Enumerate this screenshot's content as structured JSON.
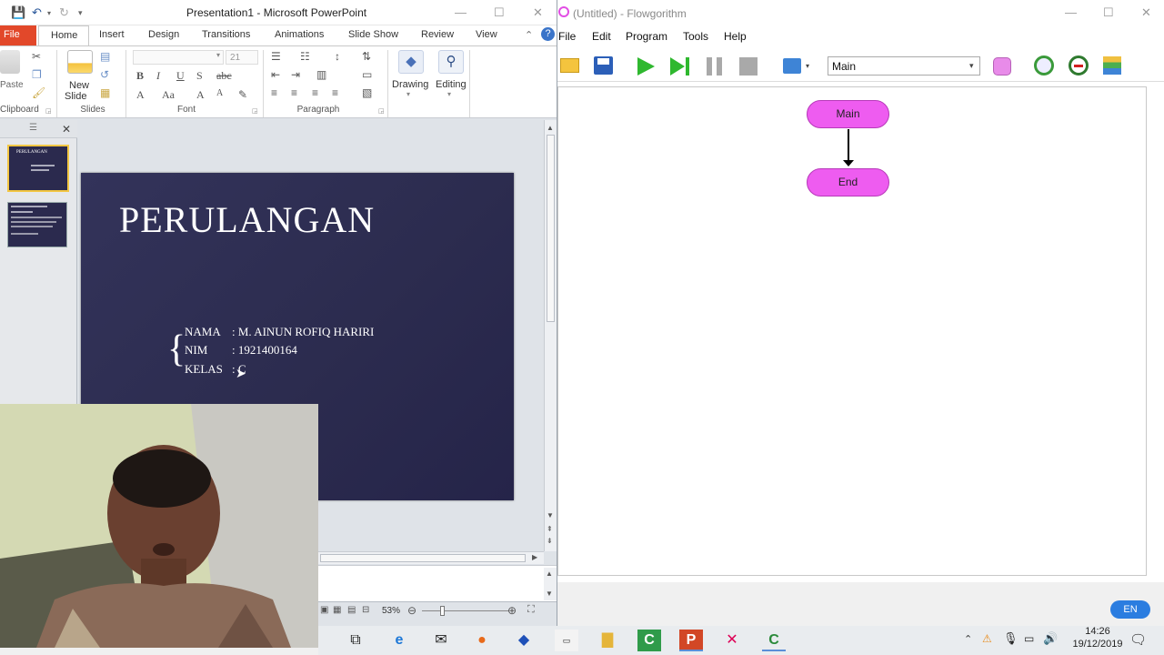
{
  "ppt": {
    "window_title": "Presentation1 - Microsoft PowerPoint",
    "tabs": [
      "File",
      "Home",
      "Insert",
      "Design",
      "Transitions",
      "Animations",
      "Slide Show",
      "Review",
      "View"
    ],
    "ribbon": {
      "paste": "Paste",
      "new_slide_line1": "New",
      "new_slide_line2": "Slide",
      "font_size": "21",
      "drawing": "Drawing",
      "editing": "Editing",
      "groups": {
        "clipboard": "Clipboard",
        "slides": "Slides",
        "font": "Font",
        "paragraph": "Paragraph"
      }
    },
    "slide": {
      "title": "PERULANGAN",
      "nama_label": "NAMA",
      "nama_value": ": M. AINUN ROFIQ HARIRI",
      "nim_label": "NIM",
      "nim_value": ": 1921400164",
      "kelas_label": "KELAS",
      "kelas_value": ": C"
    },
    "thumb1_title": "PERULANGAN",
    "zoom": "53%"
  },
  "flowgorithm": {
    "window_title": "(Untitled) - Flowgorithm",
    "menu": [
      "File",
      "Edit",
      "Program",
      "Tools",
      "Help"
    ],
    "function_select": "Main",
    "nodes": {
      "start": "Main",
      "end": "End"
    },
    "language": "EN",
    "colors": {
      "terminal": "#ee5cf0",
      "run": "#2fb82f"
    }
  },
  "taskbar": {
    "time": "14:26",
    "date": "19/12/2019"
  }
}
